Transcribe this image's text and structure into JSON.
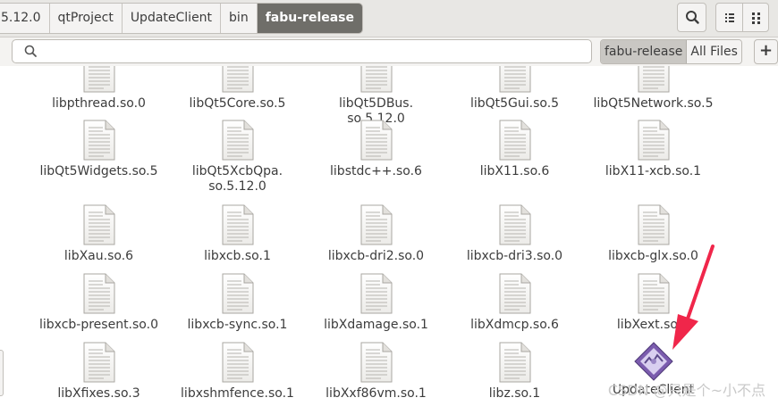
{
  "breadcrumb": [
    "5.12.0",
    "qtProject",
    "UpdateClient",
    "bin",
    "fabu-release"
  ],
  "toolbar": {
    "search_icon": "search-icon",
    "view_list_icon": "list-view-icon",
    "menu_icon": "menu-icon"
  },
  "search": {
    "placeholder": "",
    "icon": "magnifier-icon"
  },
  "scope": {
    "current_folder": "fabu-release",
    "all_files": "All Files",
    "add_label": "+"
  },
  "files": [
    [
      "libpthread.so.0",
      "libQt5Core.so.5",
      "libQt5DBus.\nso.5.12.0",
      "libQt5Gui.so.5",
      "libQt5Network.so.5"
    ],
    [
      "libQt5Widgets.so.5",
      "libQt5XcbQpa.\nso.5.12.0",
      "libstdc++.so.6",
      "libX11.so.6",
      "libX11-xcb.so.1"
    ],
    [
      "libXau.so.6",
      "libxcb.so.1",
      "libxcb-dri2.so.0",
      "libxcb-dri3.so.0",
      "libxcb-glx.so.0"
    ],
    [
      "libxcb-present.so.0",
      "libxcb-sync.so.1",
      "libXdamage.so.1",
      "libXdmcp.so.6",
      "libXext.so.6"
    ],
    [
      "libXfixes.so.3",
      "libxshmfence.so.1",
      "libXxf86vm.so.1",
      "libz.so.1",
      "UpdateClient"
    ]
  ],
  "watermark": "CSDN @只是个~小不点",
  "colors": {
    "accent_arrow": "#f0264a",
    "active_crumb": "#6f6e69",
    "executable_icon": "#7b5cae"
  }
}
